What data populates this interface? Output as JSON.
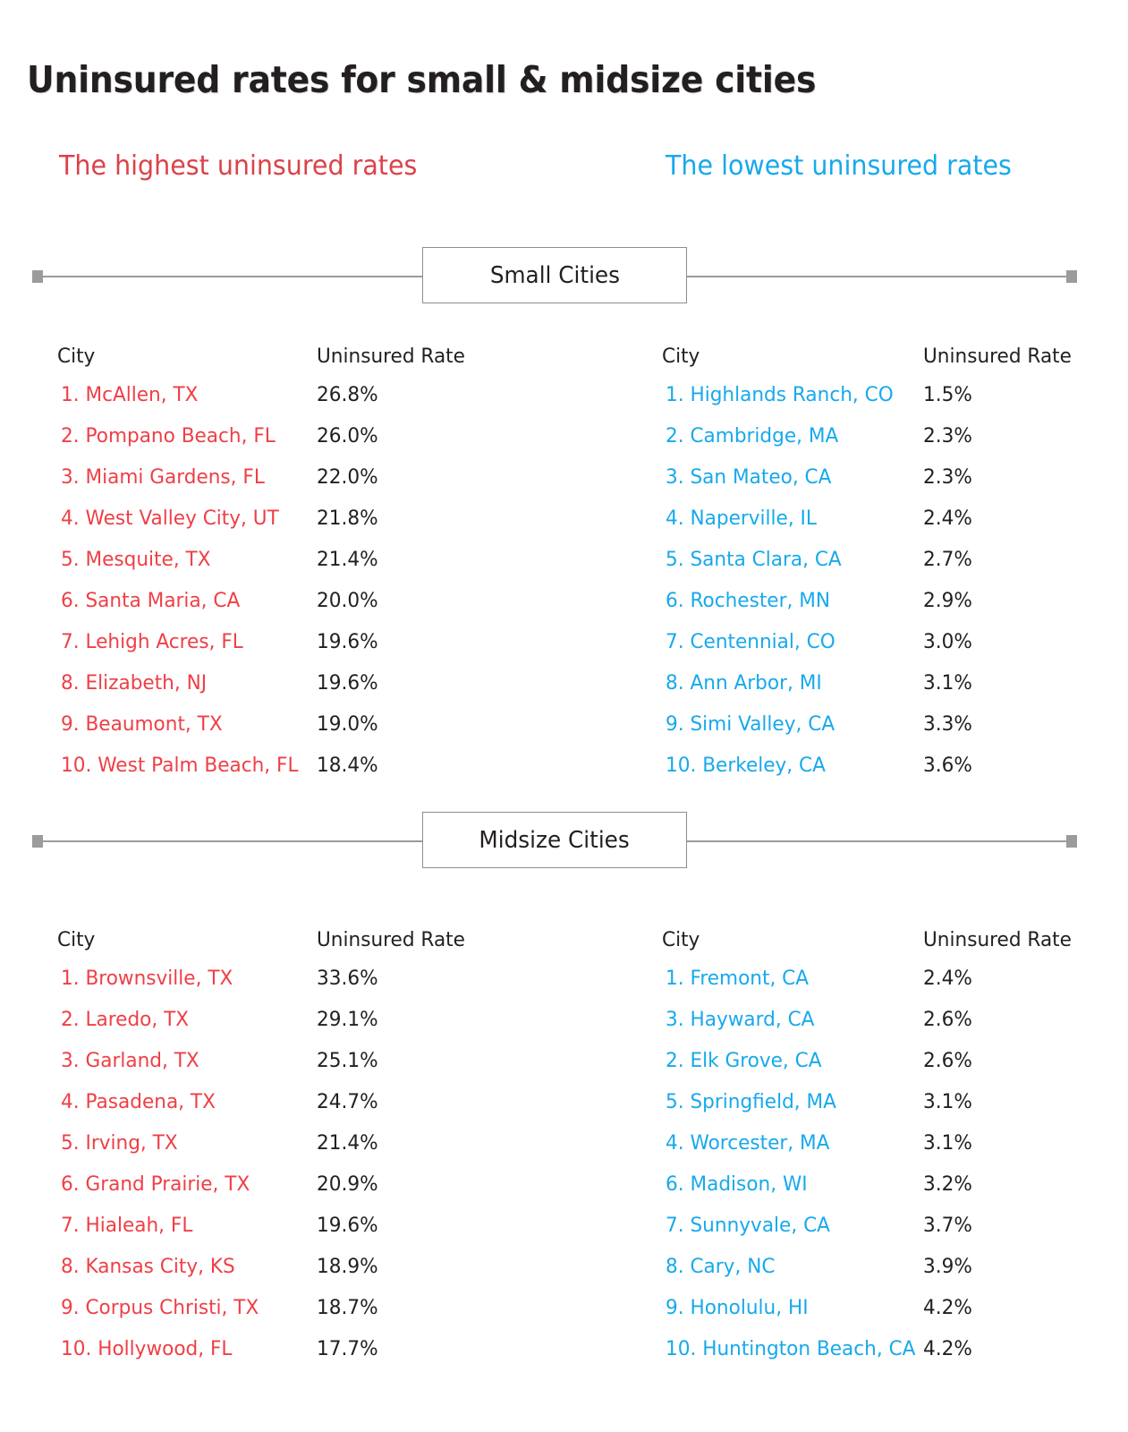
{
  "title": "Uninsured rates for small & midsize cities",
  "colors": {
    "high_red": "#ef3f46",
    "header_red": "#db4249",
    "low_blue": "#17a9ec",
    "rule_gray": "#9b9b9b",
    "text_black": "#231f20"
  },
  "headers": {
    "highest": "The highest uninsured rates",
    "lowest": "The lowest uninsured rates"
  },
  "columns": {
    "city": "City",
    "rate": "Uninsured Rate"
  },
  "sections": [
    {
      "label": "Small Cities",
      "highest": [
        {
          "city": "1. McAllen, TX",
          "rate": "26.8%"
        },
        {
          "city": "2. Pompano Beach, FL",
          "rate": "26.0%"
        },
        {
          "city": "3. Miami Gardens, FL",
          "rate": "22.0%"
        },
        {
          "city": "4. West Valley City, UT",
          "rate": "21.8%"
        },
        {
          "city": "5. Mesquite, TX",
          "rate": "21.4%"
        },
        {
          "city": "6. Santa Maria, CA",
          "rate": "20.0%"
        },
        {
          "city": "7. Lehigh Acres, FL",
          "rate": "19.6%"
        },
        {
          "city": "8. Elizabeth, NJ",
          "rate": "19.6%"
        },
        {
          "city": "9. Beaumont, TX",
          "rate": "19.0%"
        },
        {
          "city": "10. West Palm Beach, FL",
          "rate": "18.4%"
        }
      ],
      "lowest": [
        {
          "city": "1. Highlands Ranch, CO",
          "rate": "1.5%"
        },
        {
          "city": "2. Cambridge, MA",
          "rate": "2.3%"
        },
        {
          "city": "3. San Mateo, CA",
          "rate": "2.3%"
        },
        {
          "city": "4. Naperville, IL",
          "rate": "2.4%"
        },
        {
          "city": "5. Santa Clara, CA",
          "rate": "2.7%"
        },
        {
          "city": "6. Rochester, MN",
          "rate": "2.9%"
        },
        {
          "city": "7. Centennial, CO",
          "rate": "3.0%"
        },
        {
          "city": "8. Ann Arbor, MI",
          "rate": "3.1%"
        },
        {
          "city": "9. Simi Valley, CA",
          "rate": "3.3%"
        },
        {
          "city": "10. Berkeley, CA",
          "rate": "3.6%"
        }
      ]
    },
    {
      "label": "Midsize Cities",
      "highest": [
        {
          "city": "1. Brownsville, TX",
          "rate": "33.6%"
        },
        {
          "city": "2. Laredo, TX",
          "rate": "29.1%"
        },
        {
          "city": "3. Garland, TX",
          "rate": "25.1%"
        },
        {
          "city": "4. Pasadena, TX",
          "rate": "24.7%"
        },
        {
          "city": "5. Irving, TX",
          "rate": "21.4%"
        },
        {
          "city": "6. Grand Prairie, TX",
          "rate": "20.9%"
        },
        {
          "city": "7. Hialeah, FL",
          "rate": "19.6%"
        },
        {
          "city": "8. Kansas City, KS",
          "rate": "18.9%"
        },
        {
          "city": "9. Corpus Christi, TX",
          "rate": "18.7%"
        },
        {
          "city": "10. Hollywood, FL",
          "rate": "17.7%"
        }
      ],
      "lowest": [
        {
          "city": "1. Fremont, CA",
          "rate": "2.4%"
        },
        {
          "city": "3. Hayward, CA",
          "rate": "2.6%"
        },
        {
          "city": "2. Elk Grove, CA",
          "rate": "2.6%"
        },
        {
          "city": "5. Springfield, MA",
          "rate": "3.1%"
        },
        {
          "city": "4. Worcester, MA",
          "rate": "3.1%"
        },
        {
          "city": "6. Madison, WI",
          "rate": "3.2%"
        },
        {
          "city": "7. Sunnyvale, CA",
          "rate": "3.7%"
        },
        {
          "city": "8. Cary, NC",
          "rate": "3.9%"
        },
        {
          "city": "9. Honolulu, HI",
          "rate": "4.2%"
        },
        {
          "city": "10. Huntington Beach, CA",
          "rate": "4.2%"
        }
      ]
    }
  ],
  "chart_data": {
    "type": "table",
    "title": "Uninsured rates for small & midsize cities",
    "xlabel": "",
    "ylabel": "Uninsured Rate (%)",
    "grid": false,
    "legend": [
      "The highest uninsured rates",
      "The lowest uninsured rates"
    ],
    "tables": [
      {
        "group": "Small Cities",
        "series": "The highest uninsured rates",
        "columns": [
          "City",
          "Uninsured Rate"
        ],
        "categories": [
          "1. McAllen, TX",
          "2. Pompano Beach, FL",
          "3. Miami Gardens, FL",
          "4. West Valley City, UT",
          "5. Mesquite, TX",
          "6. Santa Maria, CA",
          "7. Lehigh Acres, FL",
          "8. Elizabeth, NJ",
          "9. Beaumont, TX",
          "10. West Palm Beach, FL"
        ],
        "values": [
          26.8,
          26.0,
          22.0,
          21.8,
          21.4,
          20.0,
          19.6,
          19.6,
          19.0,
          18.4
        ]
      },
      {
        "group": "Small Cities",
        "series": "The lowest uninsured rates",
        "columns": [
          "City",
          "Uninsured Rate"
        ],
        "categories": [
          "1. Highlands Ranch, CO",
          "2. Cambridge, MA",
          "3. San Mateo, CA",
          "4. Naperville, IL",
          "5. Santa Clara, CA",
          "6. Rochester, MN",
          "7. Centennial, CO",
          "8. Ann Arbor, MI",
          "9. Simi Valley, CA",
          "10. Berkeley, CA"
        ],
        "values": [
          1.5,
          2.3,
          2.3,
          2.4,
          2.7,
          2.9,
          3.0,
          3.1,
          3.3,
          3.6
        ]
      },
      {
        "group": "Midsize Cities",
        "series": "The highest uninsured rates",
        "columns": [
          "City",
          "Uninsured Rate"
        ],
        "categories": [
          "1. Brownsville, TX",
          "2. Laredo, TX",
          "3. Garland, TX",
          "4. Pasadena, TX",
          "5. Irving, TX",
          "6. Grand Prairie, TX",
          "7. Hialeah, FL",
          "8. Kansas City, KS",
          "9. Corpus Christi, TX",
          "10. Hollywood, FL"
        ],
        "values": [
          33.6,
          29.1,
          25.1,
          24.7,
          21.4,
          20.9,
          19.6,
          18.9,
          18.7,
          17.7
        ]
      },
      {
        "group": "Midsize Cities",
        "series": "The lowest uninsured rates",
        "columns": [
          "City",
          "Uninsured Rate"
        ],
        "categories": [
          "1. Fremont, CA",
          "3. Hayward, CA",
          "2. Elk Grove, CA",
          "5. Springfield, MA",
          "4. Worcester, MA",
          "6. Madison, WI",
          "7. Sunnyvale, CA",
          "8. Cary, NC",
          "9. Honolulu, HI",
          "10. Huntington Beach, CA"
        ],
        "values": [
          2.4,
          2.6,
          2.6,
          3.1,
          3.1,
          3.2,
          3.7,
          3.9,
          4.2,
          4.2
        ]
      }
    ]
  }
}
